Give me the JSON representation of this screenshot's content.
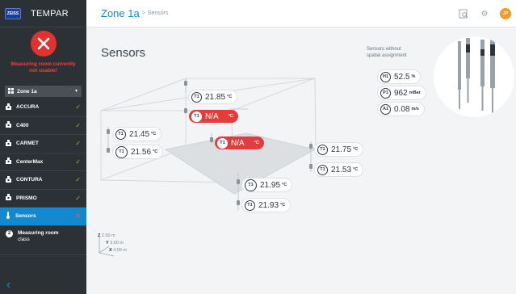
{
  "app": {
    "brand_logo": "ZEISS",
    "brand_name": "TEMPAR"
  },
  "alert": {
    "icon": "error-x-icon",
    "line1": "Measuring room currently",
    "line2": "not usable!"
  },
  "zone_select": {
    "value": "Zone 1a"
  },
  "sidebar": {
    "items": [
      {
        "label": "ACCURA",
        "status": "ok"
      },
      {
        "label": "C400",
        "status": "ok"
      },
      {
        "label": "CARMET",
        "status": "ok"
      },
      {
        "label": "CenterMax",
        "status": "ok"
      },
      {
        "label": "CONTURA",
        "status": "ok"
      },
      {
        "label": "PRISMO",
        "status": "ok"
      },
      {
        "label": "Sensors",
        "status": "error",
        "active": true
      },
      {
        "badge": "2",
        "label_line1": "Measuring room",
        "label_line2": "class"
      }
    ],
    "back_icon": "chevron-left-icon"
  },
  "header": {
    "title": "Zone 1a",
    "separator": ">",
    "subtitle": "Sensors",
    "avatar_initials": "JP"
  },
  "page_title": "Sensors",
  "sensors": [
    {
      "tag": "T1",
      "value": "21.85",
      "unit": "°C"
    },
    {
      "tag": "T1",
      "value": "N/A",
      "unit": "°C",
      "error": true
    },
    {
      "tag": "T1",
      "value": "21.45",
      "unit": "°C"
    },
    {
      "tag": "T1",
      "value": "21.56",
      "unit": "°C"
    },
    {
      "tag": "T1",
      "value": "N/A",
      "unit": "°C",
      "error": true
    },
    {
      "tag": "T1",
      "value": "21.75",
      "unit": "°C"
    },
    {
      "tag": "T1",
      "value": "21.53",
      "unit": "°C"
    },
    {
      "tag": "T1",
      "value": "21.95",
      "unit": "°C"
    },
    {
      "tag": "T1",
      "value": "21.93",
      "unit": "°C"
    }
  ],
  "unassigned": {
    "line1": "Sensors without",
    "line2": "spatial assignment",
    "items": [
      {
        "tag": "H1",
        "value": "52.5",
        "unit": "%"
      },
      {
        "tag": "P1",
        "value": "962",
        "unit": "mBar"
      },
      {
        "tag": "A1",
        "value": "0.08",
        "unit": "m/s"
      }
    ]
  },
  "axes": {
    "z": "Z",
    "z_val": "2.00 m",
    "y": "Y",
    "y_val": "3.00 m",
    "x": "X",
    "x_val": "4.00 m"
  },
  "colors": {
    "accent": "#1488cc",
    "error": "#e23d3b",
    "ok": "#78c940",
    "sidebar": "#2c3135"
  }
}
